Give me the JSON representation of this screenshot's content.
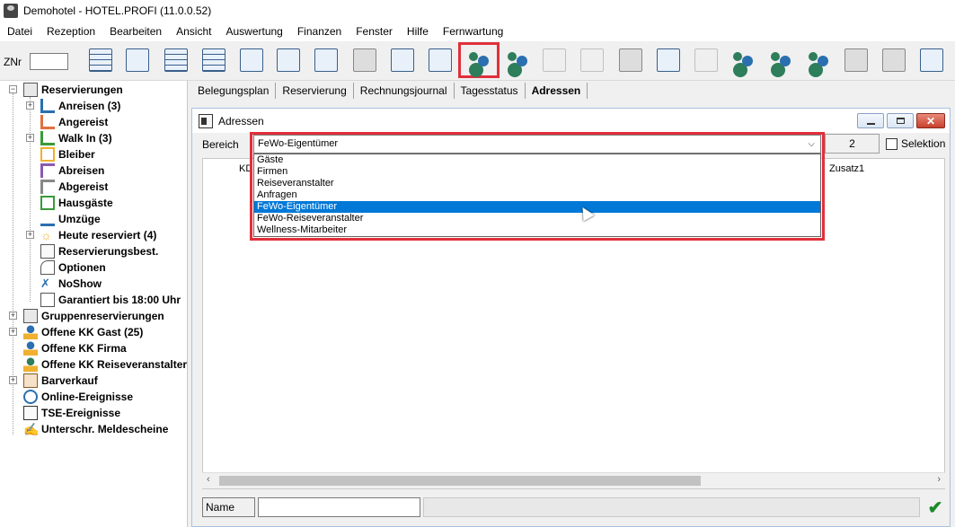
{
  "window": {
    "title": "Demohotel - HOTEL.PROFI (11.0.0.52)"
  },
  "menu": [
    "Datei",
    "Rezeption",
    "Bearbeiten",
    "Ansicht",
    "Auswertung",
    "Finanzen",
    "Fenster",
    "Hilfe",
    "Fernwartung"
  ],
  "toolbar": {
    "znr_label": "ZNr",
    "znr_value": ""
  },
  "sidebar": {
    "root": "Reservierungen",
    "children": [
      "Anreisen (3)",
      "Angereist",
      "Walk In (3)",
      "Bleiber",
      "Abreisen",
      "Abgereist",
      "Hausgäste",
      "Umzüge",
      "Heute reserviert (4)",
      "Reservierungsbest.",
      "Optionen",
      "NoShow",
      "Garantiert bis 18:00 Uhr"
    ],
    "top_items": [
      "Gruppenreservierungen",
      "Offene KK Gast (25)",
      "Offene KK Firma",
      "Offene KK Reiseveranstalter",
      "Barverkauf",
      "Online-Ereignisse",
      "TSE-Ereignisse",
      "Unterschr. Meldescheine"
    ]
  },
  "tabs": [
    "Belegungsplan",
    "Reservierung",
    "Rechnungsjournal",
    "Tagesstatus",
    "Adressen"
  ],
  "adressen": {
    "title": "Adressen",
    "bereich_label": "Bereich",
    "bereich_value": "FeWo-Eigentümer",
    "count": "2",
    "selektion_label": "Selektion",
    "options": [
      "Gäste",
      "Firmen",
      "Reiseveranstalter",
      "Anfragen",
      "FeWo-Eigentümer",
      "FeWo-Reiseveranstalter",
      "Wellness-Mitarbeiter"
    ],
    "selected_index": 4,
    "col_kd": "KD",
    "col_zusatz": "Zusatz1",
    "name_label": "Name",
    "name_value": ""
  },
  "colors": {
    "highlight": "#e0303a",
    "selection": "#0078d7"
  }
}
